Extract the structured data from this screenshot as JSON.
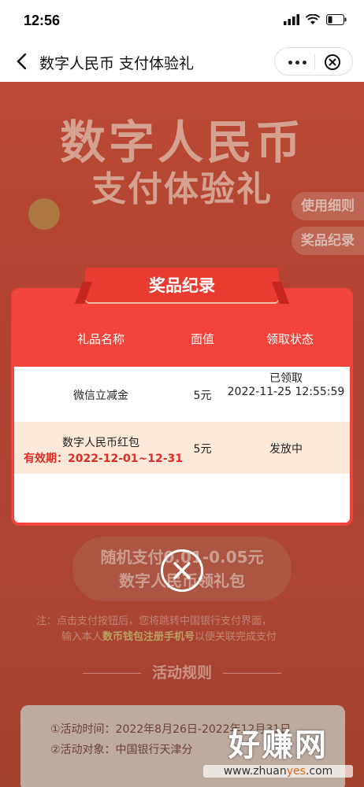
{
  "status_bar": {
    "time": "12:56"
  },
  "nav": {
    "title": "数字人民币 支付体验礼"
  },
  "background": {
    "hero_line1": "数字人民币",
    "hero_line2": "支付体验礼",
    "side_buttons": [
      "使用细则",
      "奖品纪录"
    ],
    "pay_button_line1": "随机支付0.01-0.05元",
    "pay_button_line2": "数字人民币领礼包",
    "note_prefix": "注：点击支付按钮后，您将跳转中国银行支付界面，",
    "note_mid_prefix": "输入本人",
    "note_highlight": "数币钱包注册手机号",
    "note_suffix": "以便关联完成支付",
    "rules_title": "活动规则",
    "rules_items": [
      "①活动时间：2022年8月26日-2022年12月31日",
      "②活动对象：中国银行天津分"
    ]
  },
  "modal": {
    "title": "奖品纪录",
    "columns": [
      "礼品名称",
      "面值",
      "领取状态"
    ],
    "rows": [
      {
        "name": "微信立减金",
        "value": "5元",
        "status": "已领取",
        "status_time": "2022-11-25 12:55:59"
      },
      {
        "name": "数字人民币红包",
        "validity": "有效期：2022-12-01~12-31",
        "value": "5元",
        "status": "发放中"
      }
    ]
  },
  "watermark": {
    "big": "好赚网",
    "small_a": "www.zhuan",
    "small_b": "yes",
    "small_c": ".com"
  },
  "colors": {
    "modal_red": "#f2443a",
    "validity_red": "#e22b24",
    "row_highlight": "#fde9da"
  }
}
